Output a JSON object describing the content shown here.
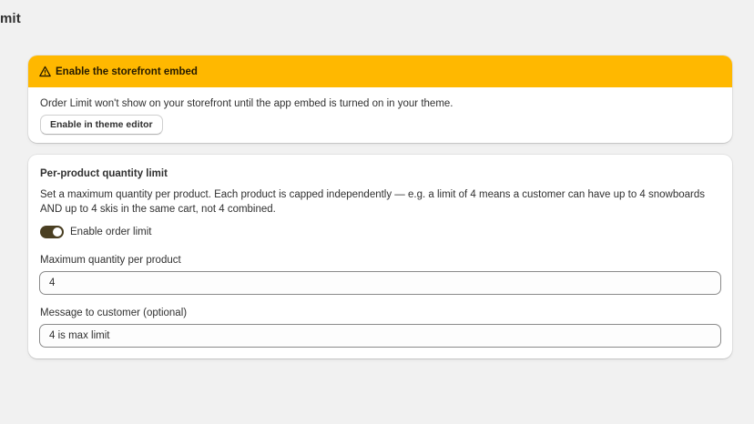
{
  "page": {
    "title": "mit"
  },
  "banner": {
    "title": "Enable the storefront embed",
    "icon": "warning-triangle-icon",
    "accent_color": "#ffb800",
    "text": "Order Limit won't show on your storefront until the app embed is turned on in your theme.",
    "button_label": "Enable in theme editor"
  },
  "settings": {
    "title": "Per-product quantity limit",
    "description": "Set a maximum quantity per product. Each product is capped independently — e.g. a limit of 4 means a customer can have up to 4 snowboards AND up to 4 skis in the same cart, not 4 combined.",
    "toggle": {
      "label": "Enable order limit",
      "enabled": true
    },
    "max_quantity": {
      "label": "Maximum quantity per product",
      "value": "4"
    },
    "message": {
      "label": "Message to customer (optional)",
      "value": "4 is max limit"
    }
  }
}
